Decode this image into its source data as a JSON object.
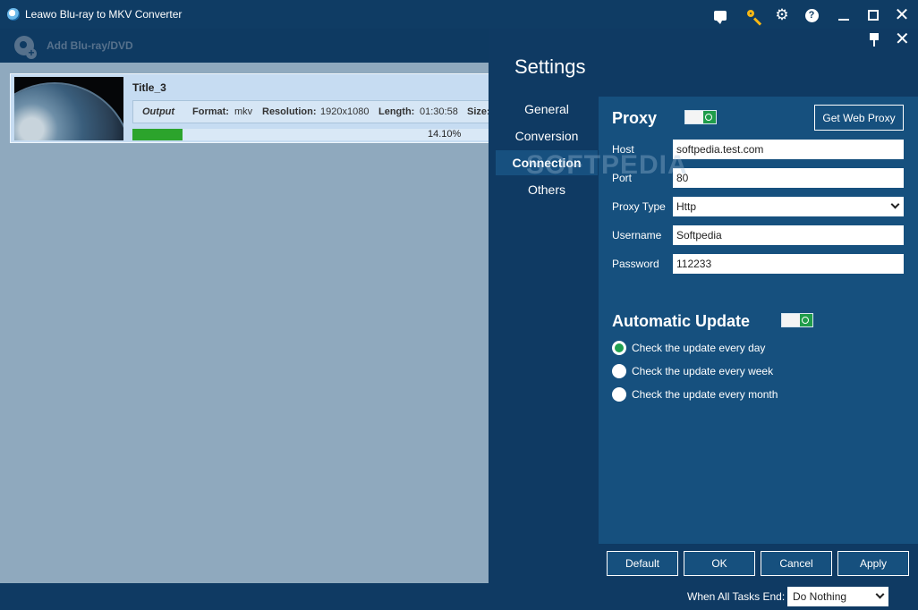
{
  "window": {
    "title": "Leawo Blu-ray to MKV Converter"
  },
  "toolbar": {
    "add_label": "Add Blu-ray/DVD"
  },
  "task": {
    "title": "Title_3",
    "output_label": "Output",
    "format_label": "Format:",
    "format_value": "mkv",
    "resolution_label": "Resolution:",
    "resolution_value": "1920x1080",
    "length_label": "Length:",
    "length_value": "01:30:58",
    "size_label": "Size:",
    "progress_percent": 14.1,
    "progress_text": "14.10%"
  },
  "settings": {
    "title": "Settings",
    "nav": [
      {
        "label": "General"
      },
      {
        "label": "Conversion"
      },
      {
        "label": "Connection",
        "active": true
      },
      {
        "label": "Others"
      }
    ],
    "watermark": "SOFTPEDIA",
    "proxy": {
      "title": "Proxy",
      "enabled": true,
      "get_web_proxy": "Get Web Proxy",
      "host_label": "Host",
      "host_value": "softpedia.test.com",
      "port_label": "Port",
      "port_value": "80",
      "type_label": "Proxy Type",
      "type_value": "Http",
      "username_label": "Username",
      "username_value": "Softpedia",
      "password_label": "Password",
      "password_value": "112233"
    },
    "update": {
      "title": "Automatic Update",
      "enabled": true,
      "options": [
        {
          "label": "Check the update every day",
          "checked": true
        },
        {
          "label": "Check the update every week",
          "checked": false
        },
        {
          "label": "Check the update every month",
          "checked": false
        }
      ]
    },
    "buttons": {
      "default": "Default",
      "ok": "OK",
      "cancel": "Cancel",
      "apply": "Apply"
    }
  },
  "bottom": {
    "end_label": "When All Tasks End:",
    "end_value": "Do Nothing"
  },
  "colors": {
    "progress": "#2ca42c",
    "toggle_on": "#1f9c4a",
    "panel": "#16507e"
  }
}
